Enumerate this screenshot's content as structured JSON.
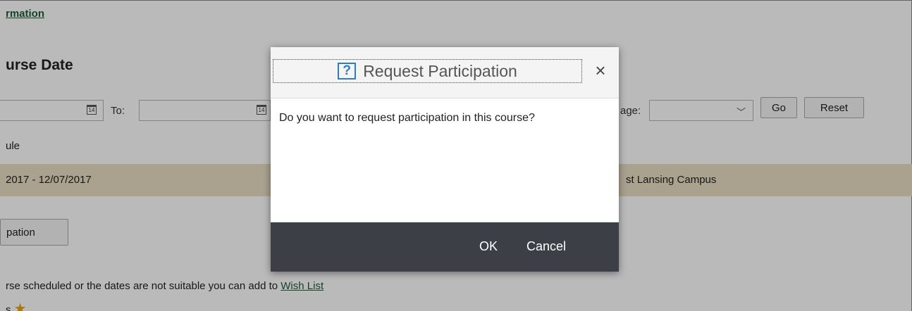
{
  "page": {
    "info_link": "rmation",
    "section_title": "urse Date",
    "filter": {
      "to_label": "To:",
      "language_label": "age:",
      "language_value": "",
      "go_label": "Go",
      "reset_label": "Reset"
    },
    "schedule_label": "ule",
    "row": {
      "dates": "2017 - 12/07/2017",
      "location": "st Lansing Campus"
    },
    "participation_button": "pation",
    "wishlist_text": "rse scheduled or the dates are not suitable you can add to ",
    "wishlist_link": "Wish List",
    "star_row_text": "s"
  },
  "dialog": {
    "title": "Request Participation",
    "help_icon": "?",
    "close_icon": "×",
    "message": "Do you want to request participation in this course?",
    "ok_label": "OK",
    "cancel_label": "Cancel"
  },
  "icons": {
    "calendar": "calendar-icon",
    "chevron": "chevron-down-icon",
    "star": "star-icon",
    "help": "help-icon",
    "close": "close-icon"
  },
  "colors": {
    "link": "#1e5c3a",
    "row_highlight": "#e9dfc4",
    "help_blue": "#2f7dc1",
    "footer": "#3c4046",
    "star": "#e8a317"
  }
}
